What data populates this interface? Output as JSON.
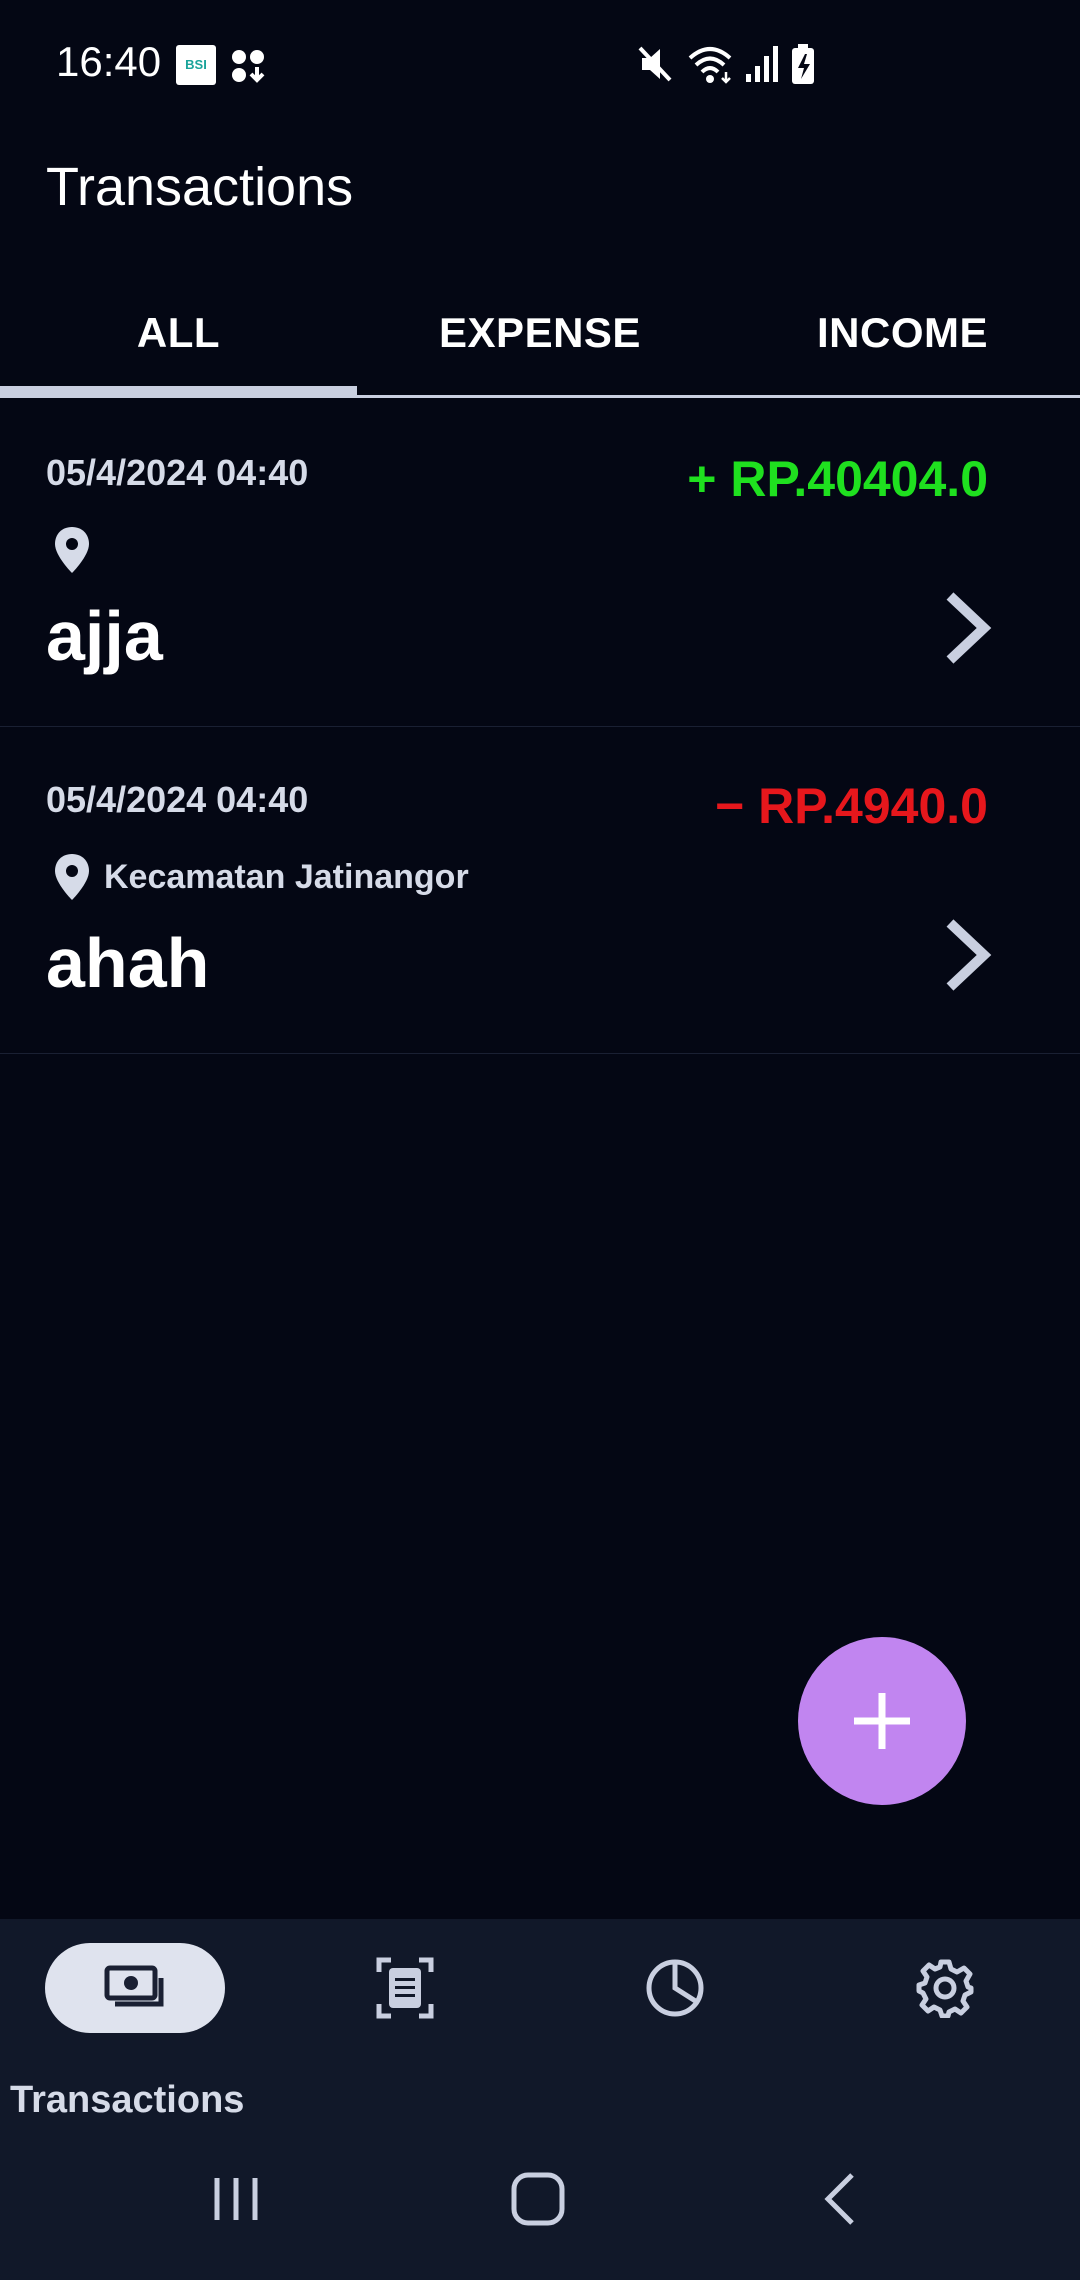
{
  "status_bar": {
    "time": "16:40",
    "bsi_icon_text": "BSI",
    "icons": [
      "bsi-app-icon",
      "notification-dots-icon",
      "mute-icon",
      "wifi-icon",
      "signal-icon",
      "battery-charging-icon"
    ]
  },
  "header": {
    "title": "Transactions"
  },
  "tabs": [
    {
      "label": "ALL",
      "selected": true
    },
    {
      "label": "EXPENSE",
      "selected": false
    },
    {
      "label": "INCOME",
      "selected": false
    }
  ],
  "transactions": [
    {
      "date": "05/4/2024 04:40",
      "amount": "+ RP.40404.0",
      "type": "income",
      "location": "",
      "title": "ajja"
    },
    {
      "date": "05/4/2024 04:40",
      "amount": "− RP.4940.0",
      "type": "expense",
      "location": "Kecamatan Jatinangor",
      "title": "ahah"
    }
  ],
  "fab": {
    "icon": "plus-icon"
  },
  "bottom_nav": {
    "items": [
      {
        "label": "Transactions",
        "icon": "money-stack-icon",
        "selected": true
      },
      {
        "label": "",
        "icon": "receipt-scan-icon",
        "selected": false
      },
      {
        "label": "",
        "icon": "pie-chart-icon",
        "selected": false
      },
      {
        "label": "",
        "icon": "gear-icon",
        "selected": false
      }
    ]
  },
  "colors": {
    "background": "#040714",
    "income": "#1fe01f",
    "expense": "#e6171c",
    "fab": "#c185f0",
    "nav_background": "#111829",
    "tab_indicator": "#c9cfe0"
  },
  "system_nav": {
    "buttons": [
      "recents-icon",
      "home-icon",
      "back-icon"
    ]
  }
}
